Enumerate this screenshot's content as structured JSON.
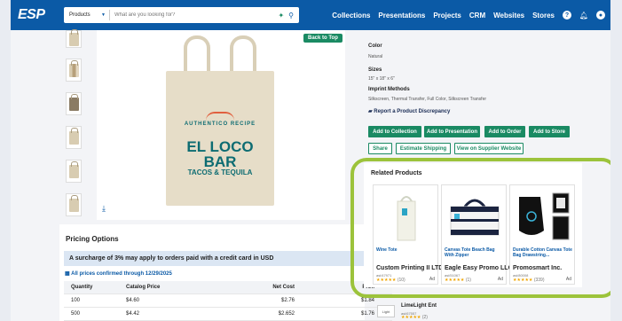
{
  "topnav": {
    "logo": "ESP",
    "search_category": "Products",
    "search_placeholder": "What are you looking for?",
    "links": [
      "Collections",
      "Presentations",
      "Projects",
      "CRM",
      "Websites",
      "Stores"
    ],
    "icons": [
      "help-icon",
      "bell-icon",
      "user-icon"
    ]
  },
  "product": {
    "back_to_top": "Back to Top",
    "tote_print": {
      "line1": "AUTHENTICO RECIPE",
      "line2a": "EL LOCO",
      "line2b": "BAR",
      "line3": "TACOS & TEQUILA"
    },
    "color_label": "Color",
    "color_value": "Natural",
    "sizes_label": "Sizes",
    "sizes_value": "15\" x 18\" x 6\"",
    "imprint_label": "Imprint Methods",
    "imprint_value": "Silkscreen, Thermal Transfer, Full Color, Silkscreen Transfer",
    "discrepancy": "Report a Product Discrepancy",
    "buttons": {
      "add_collection": "Add to Collection",
      "add_presentation": "Add to Presentation",
      "add_order": "Add to Order",
      "add_store": "Add to Store",
      "share": "Share",
      "estimate": "Estimate Shipping",
      "view_supplier": "View on Supplier Website"
    }
  },
  "pricing": {
    "title": "Pricing Options",
    "surcharge": "A surcharge of 3% may apply to orders paid with a credit card in USD",
    "confirmed": "All prices confirmed through 12/29/2025",
    "headers": [
      "Quantity",
      "Catalog Price",
      "Net Cost",
      "Profi"
    ],
    "rows": [
      [
        "100",
        "$4.60",
        "$2.76",
        "$1.84"
      ],
      [
        "500",
        "$4.42",
        "$2.652",
        "$1.76"
      ]
    ]
  },
  "related": {
    "title": "Related Products",
    "cards": [
      {
        "name": "Wine Tote",
        "supplier": "Custom Printing II LTD",
        "asi": "asi/47971",
        "stars": "★★★★★",
        "reviews": "(10)",
        "ad": "Ad"
      },
      {
        "name": "Canvas Tote Beach Bag With Zipper",
        "supplier": "Eagle Easy Promo LLC",
        "asi": "asi/51067",
        "stars": "★★★★★",
        "reviews": "(1)",
        "ad": "Ad"
      },
      {
        "name": "Durable Cotton Canvas Tote Bag Drawstring...",
        "supplier": "Promosmart Inc.",
        "asi": "asi/80008",
        "stars": "★★★★★",
        "reviews": "(339)",
        "ad": "Ad"
      }
    ]
  },
  "bottom_supplier": {
    "logo_text": "Light",
    "name": "LimeLight Ent",
    "asi": "asi/67557",
    "stars": "★★★★★",
    "reviews": "(2)"
  }
}
